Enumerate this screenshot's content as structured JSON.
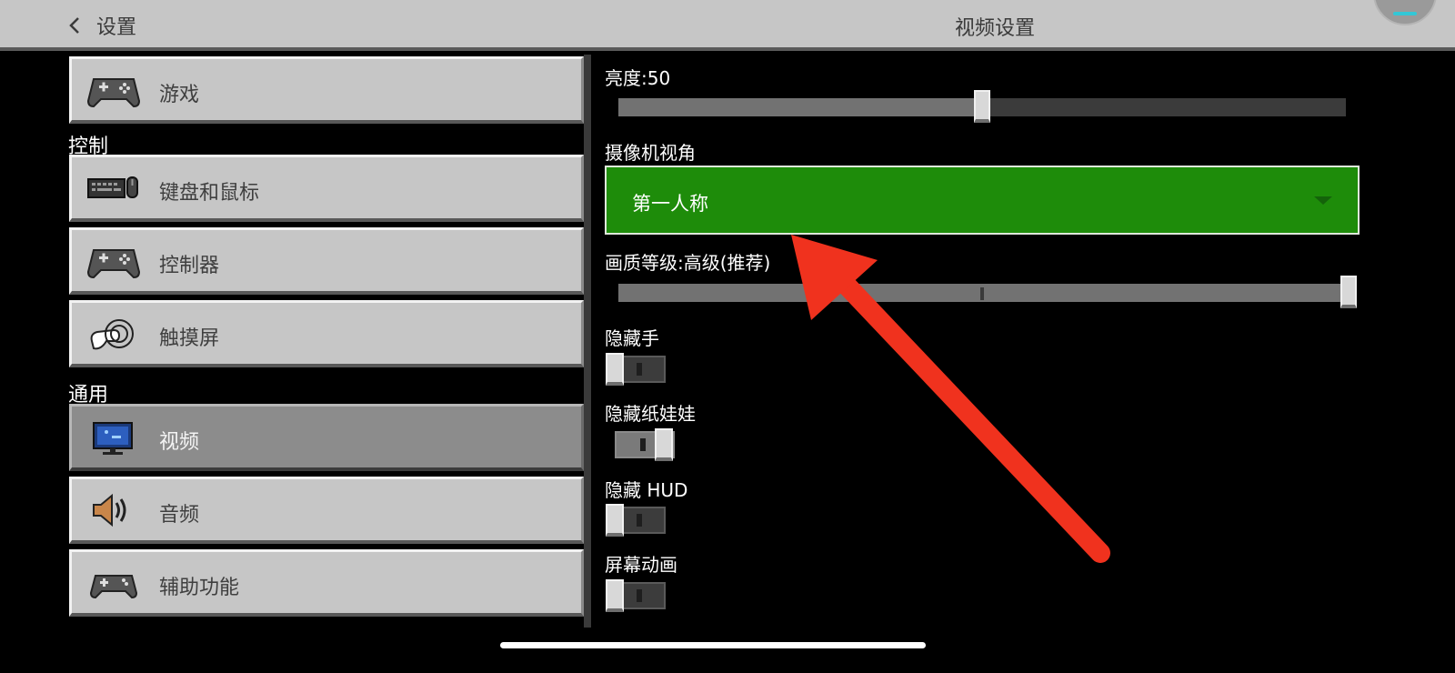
{
  "header": {
    "back_label": "设置",
    "title": "视频设置"
  },
  "left_panel": {
    "sections": [
      {
        "label": ""
      },
      {
        "label": "控制"
      },
      {
        "label": "通用"
      }
    ],
    "items": [
      {
        "label": "游戏",
        "icon": "gamepad-icon",
        "active": false
      },
      {
        "label": "键盘和鼠标",
        "icon": "keyboard-mouse-icon",
        "active": false
      },
      {
        "label": "控制器",
        "icon": "controller-icon",
        "active": false
      },
      {
        "label": "触摸屏",
        "icon": "touch-hand-icon",
        "active": false
      },
      {
        "label": "视频",
        "icon": "monitor-icon",
        "active": true
      },
      {
        "label": "音频",
        "icon": "speaker-icon",
        "active": false
      },
      {
        "label": "辅助功能",
        "icon": "accessibility-gamepad-icon",
        "active": false
      }
    ]
  },
  "settings": {
    "brightness": {
      "label": "亮度:50",
      "value": 50,
      "min": 0,
      "max": 100
    },
    "camera_perspective": {
      "label": "摄像机视角",
      "value": "第一人称"
    },
    "graphics_quality": {
      "label": "画质等级:高级(推荐)",
      "level": "max"
    },
    "hide_hand": {
      "label": "隐藏手",
      "on": false
    },
    "hide_paperdoll": {
      "label": "隐藏纸娃娃",
      "on": true
    },
    "hide_hud": {
      "label": "隐藏 HUD",
      "on": false
    },
    "screen_animations": {
      "label": "屏幕动画",
      "on": false
    }
  },
  "colors": {
    "accent_green": "#1e8c0a",
    "annotation_red": "#f0321e",
    "button_gray": "#c6c6c6"
  }
}
